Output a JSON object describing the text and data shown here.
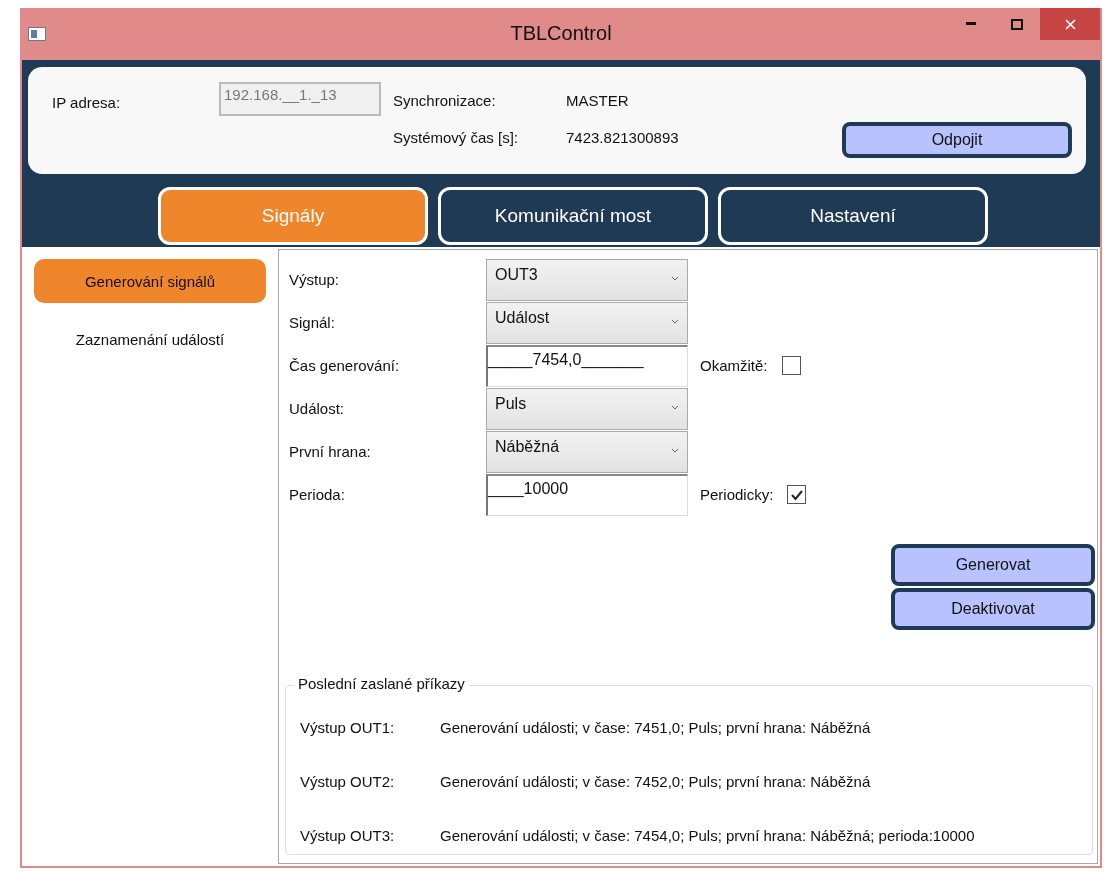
{
  "window": {
    "title": "TBLControl"
  },
  "connection": {
    "ip_label": "IP adresa:",
    "ip_value": "192.168.__1._13",
    "sync_label": "Synchronizace:",
    "sync_value": "MASTER",
    "time_label": "Systémový čas [s]:",
    "time_value": "7423.821300893",
    "disconnect_button": "Odpojit"
  },
  "tabs": [
    {
      "label": "Signály",
      "selected": true
    },
    {
      "label": "Komunikační most",
      "selected": false
    },
    {
      "label": "Nastavení",
      "selected": false
    }
  ],
  "sidebar": {
    "items": [
      {
        "label": "Generování signálů",
        "selected": true
      },
      {
        "label": "Zaznamenání událostí",
        "selected": false
      }
    ]
  },
  "form": {
    "rows": [
      {
        "label": "Výstup:",
        "kind": "select",
        "value": "OUT3"
      },
      {
        "label": "Signál:",
        "kind": "select",
        "value": "Událost"
      },
      {
        "label": "Čas generování:",
        "kind": "input",
        "value": "_____7454,0_______",
        "option": {
          "label": "Okamžitě:",
          "checked": false
        }
      },
      {
        "label": "Událost:",
        "kind": "select",
        "value": "Puls"
      },
      {
        "label": "První hrana:",
        "kind": "select",
        "value": "Náběžná"
      },
      {
        "label": "Perioda:",
        "kind": "input",
        "value": "____10000",
        "option": {
          "label": "Periodicky:",
          "checked": true
        }
      }
    ],
    "buttons": [
      "Generovat",
      "Deaktivovat"
    ]
  },
  "history": {
    "title": "Poslední zaslané příkazy",
    "rows": [
      {
        "output": "Výstup OUT1:",
        "command": "Generování události; v čase: 7451,0; Puls; první hrana: Náběžná"
      },
      {
        "output": "Výstup OUT2:",
        "command": "Generování události; v čase: 7452,0; Puls; první hrana: Náběžná"
      },
      {
        "output": "Výstup OUT3:",
        "command": "Generování události; v čase: 7454,0; Puls; první hrana: Náběžná; perioda:10000"
      }
    ]
  }
}
